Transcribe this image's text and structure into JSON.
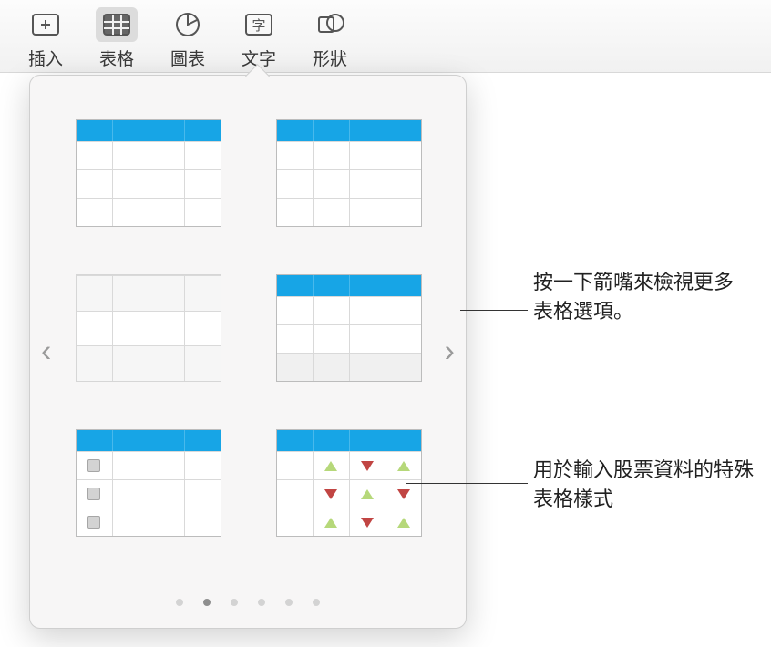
{
  "toolbar": {
    "items": [
      {
        "id": "insert",
        "label": "插入"
      },
      {
        "id": "table",
        "label": "表格"
      },
      {
        "id": "chart",
        "label": "圖表"
      },
      {
        "id": "text",
        "label": "文字"
      },
      {
        "id": "shape",
        "label": "形狀"
      }
    ],
    "active_id": "table"
  },
  "popover": {
    "page_count": 6,
    "active_page": 1,
    "nav": {
      "prev": "‹",
      "next": "›"
    }
  },
  "callouts": {
    "arrow_hint": "按一下箭嘴來檢視更多表格選項。",
    "stock_hint": "用於輸入股票資料的特殊表格樣式"
  },
  "colors": {
    "accent_blue": "#17a5e6",
    "tri_up": "#b6d87a",
    "tri_down": "#c14543"
  }
}
